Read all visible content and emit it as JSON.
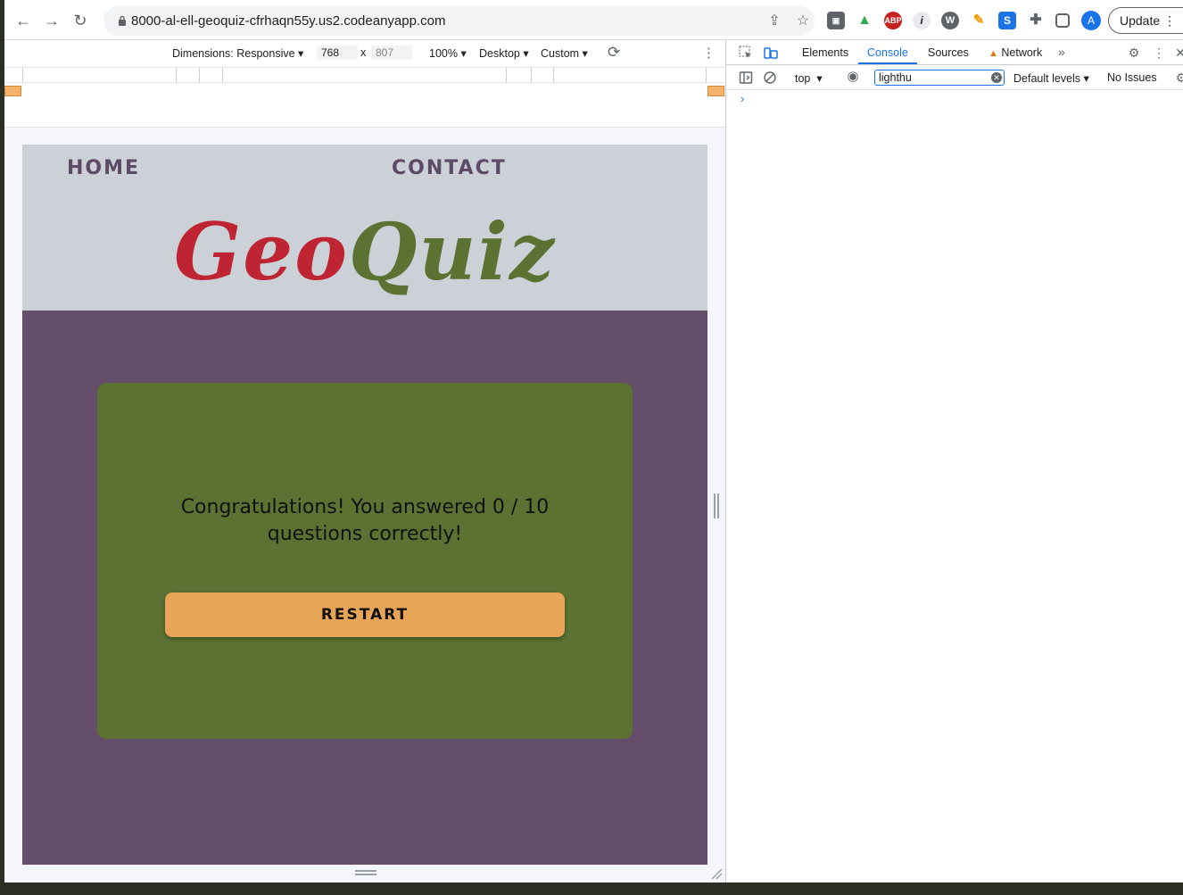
{
  "browser": {
    "url": "8000-al-ell-geoquiz-cfrhaqn55y.us2.codeanyapp.com",
    "avatar_initial": "A",
    "update_label": "Update",
    "extensions": [
      "google-drive",
      "adblock-plus",
      "info",
      "wordpress",
      "color-picker",
      "s-extension",
      "puzzle"
    ]
  },
  "device_toolbar": {
    "dimensions_label": "Dimensions: Responsive",
    "width": "768",
    "times": "x",
    "height_placeholder": "807",
    "zoom": "100%",
    "device_type": "Desktop",
    "throttle": "Custom"
  },
  "site": {
    "nav": {
      "home": "HOME",
      "contact": "CONTACT"
    },
    "logo": {
      "part1": "Geo",
      "part2": "Quiz"
    },
    "result": "Congratulations! You answered 0 / 10 questions correctly!",
    "restart_label": "RESTART",
    "colors": {
      "header": "#ccd1d8",
      "main": "#654e6a",
      "card": "#5b7233",
      "button": "#e8a457",
      "geo": "#bf2433",
      "quiz": "#5b7233"
    }
  },
  "devtools": {
    "tabs": [
      "Elements",
      "Console",
      "Sources",
      "Network"
    ],
    "active_tab": "Console",
    "more": "»",
    "context": "top",
    "filter_value": "lighthu",
    "levels": "Default levels",
    "issues": "No Issues",
    "prompt": "›"
  }
}
